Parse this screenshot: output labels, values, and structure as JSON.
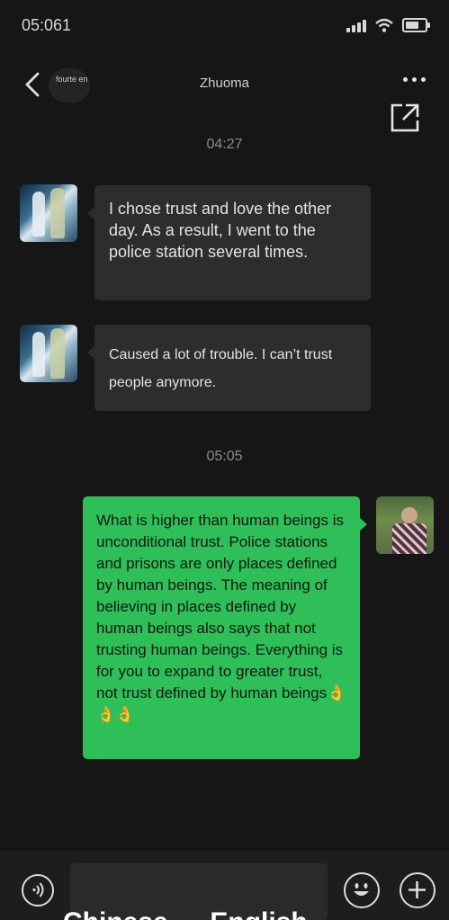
{
  "status": {
    "time": "05:061"
  },
  "header": {
    "badge_text": "fourte en",
    "title": "Zhuoma"
  },
  "messages": [
    {
      "type": "timestamp",
      "text": "04:27"
    },
    {
      "type": "received",
      "text": "I chose trust and love the other day. As a result, I went to the police station several times."
    },
    {
      "type": "received",
      "text": "Caused a lot of trouble. I can’t trust people anymore."
    },
    {
      "type": "timestamp",
      "text": "05:05"
    },
    {
      "type": "sent",
      "text": "What is higher than human beings is unconditional trust. Police stations and prisons are only places defined by human beings. The meaning of believing in places defined by human beings also says that not trusting human beings. Everything is for you to expand to greater trust, not trust defined by human beings👌👌👌"
    }
  ],
  "caption": "Chinese → English",
  "icons": {
    "back": "chevron-left-icon",
    "more": "more-dots-icon",
    "expand": "external-link-icon",
    "voice": "voice-icon",
    "emoji": "emoji-icon",
    "plus": "plus-icon"
  },
  "colors": {
    "background": "#161616",
    "received_bubble": "#2d2d2d",
    "sent_bubble": "#2fbf59"
  }
}
